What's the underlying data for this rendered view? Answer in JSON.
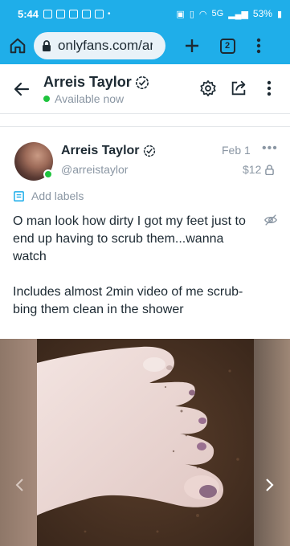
{
  "status_bar": {
    "time": "5:44",
    "network": "5G",
    "battery": "53%"
  },
  "browser": {
    "url": "onlyfans.com/arr",
    "tab_count": "2"
  },
  "profile": {
    "name": "Arreis Taylor",
    "status": "Available now"
  },
  "post": {
    "author_name": "Arreis Taylor",
    "handle": "@arreistaylor",
    "date": "Feb 1",
    "price": "$12",
    "add_labels": "Add labels",
    "paragraph_1": "O man look how dirty I got my feet just to end up having to scrub them...wanna watch",
    "paragraph_2": "Includes almost 2min video of me scrub-bing them clean in the shower"
  },
  "colors": {
    "brand": "#1faee9",
    "online": "#1fc43e",
    "muted": "#8a96a3",
    "text": "#1d2a33"
  },
  "icons": [
    "home-icon",
    "lock-icon",
    "plus-icon",
    "tabs-icon",
    "kebab-icon",
    "back-arrow-icon",
    "verified-icon",
    "settings-icon",
    "share-icon",
    "more-icon",
    "tag-icon",
    "eye-off-icon",
    "chevron-left-icon",
    "chevron-right-icon"
  ]
}
